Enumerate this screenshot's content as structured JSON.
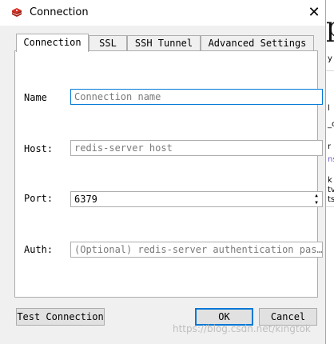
{
  "window": {
    "title": "Connection",
    "close_glyph": "✕"
  },
  "tabs": [
    {
      "label": "Connection"
    },
    {
      "label": "SSL"
    },
    {
      "label": "SSH Tunnel"
    },
    {
      "label": "Advanced Settings"
    }
  ],
  "form": {
    "name": {
      "label": "Name",
      "value": "",
      "placeholder": "Connection name"
    },
    "host": {
      "label": "Host:",
      "value": "",
      "placeholder": "redis-server host"
    },
    "port": {
      "label": "Port:",
      "value": "6379"
    },
    "auth": {
      "label": "Auth:",
      "value": "",
      "placeholder": "(Optional) redis-server authentication pas…"
    }
  },
  "buttons": {
    "test": "Test Connection",
    "ok": "OK",
    "cancel": "Cancel"
  },
  "watermark": "https://blog.csdn.net/kingtok",
  "colors": {
    "accent": "#0078d7",
    "app_icon": "#d82c20"
  },
  "icons": {
    "app": "redis-logo-icon",
    "close": "close-icon",
    "spin_up": "spin-up-icon",
    "spin_down": "spin-down-icon"
  }
}
